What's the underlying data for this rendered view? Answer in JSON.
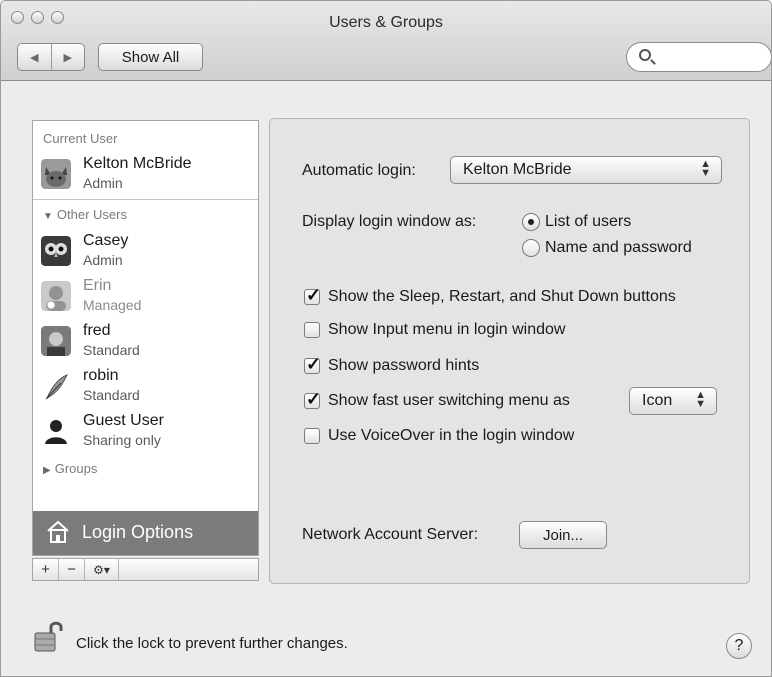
{
  "window": {
    "title": "Users & Groups"
  },
  "toolbar": {
    "back_icon": "back-arrow-icon",
    "forward_icon": "forward-arrow-icon",
    "show_all_label": "Show All",
    "search_placeholder": ""
  },
  "sidebar": {
    "current_user_heading": "Current User",
    "current_user": {
      "name": "Kelton McBride",
      "role": "Admin"
    },
    "other_users_heading": "Other Users",
    "other_users": [
      {
        "name": "Casey",
        "role": "Admin"
      },
      {
        "name": "Erin",
        "role": "Managed"
      },
      {
        "name": "fred",
        "role": "Standard"
      },
      {
        "name": "robin",
        "role": "Standard"
      },
      {
        "name": "Guest User",
        "role": "Sharing only"
      }
    ],
    "groups_heading": "Groups",
    "login_options_label": "Login Options",
    "add_label": "+",
    "remove_label": "−",
    "action_label": "⚙▾"
  },
  "panel": {
    "automatic_login_label": "Automatic login:",
    "automatic_login_value": "Kelton McBride",
    "display_login_label": "Display login window as:",
    "display_options": [
      {
        "label": "List of users",
        "selected": true
      },
      {
        "label": "Name and password",
        "selected": false
      }
    ],
    "checkboxes": [
      {
        "label": "Show the Sleep, Restart, and Shut Down buttons",
        "checked": true
      },
      {
        "label": "Show Input menu in login window",
        "checked": false
      },
      {
        "label": "Show password hints",
        "checked": true
      },
      {
        "label": "Show fast user switching menu as",
        "checked": true
      },
      {
        "label": "Use VoiceOver in the login window",
        "checked": false
      }
    ],
    "fast_switch_value": "Icon",
    "network_server_label": "Network Account Server:",
    "join_label": "Join..."
  },
  "footer": {
    "lock_text": "Click the lock to prevent further changes.",
    "help_label": "?"
  }
}
